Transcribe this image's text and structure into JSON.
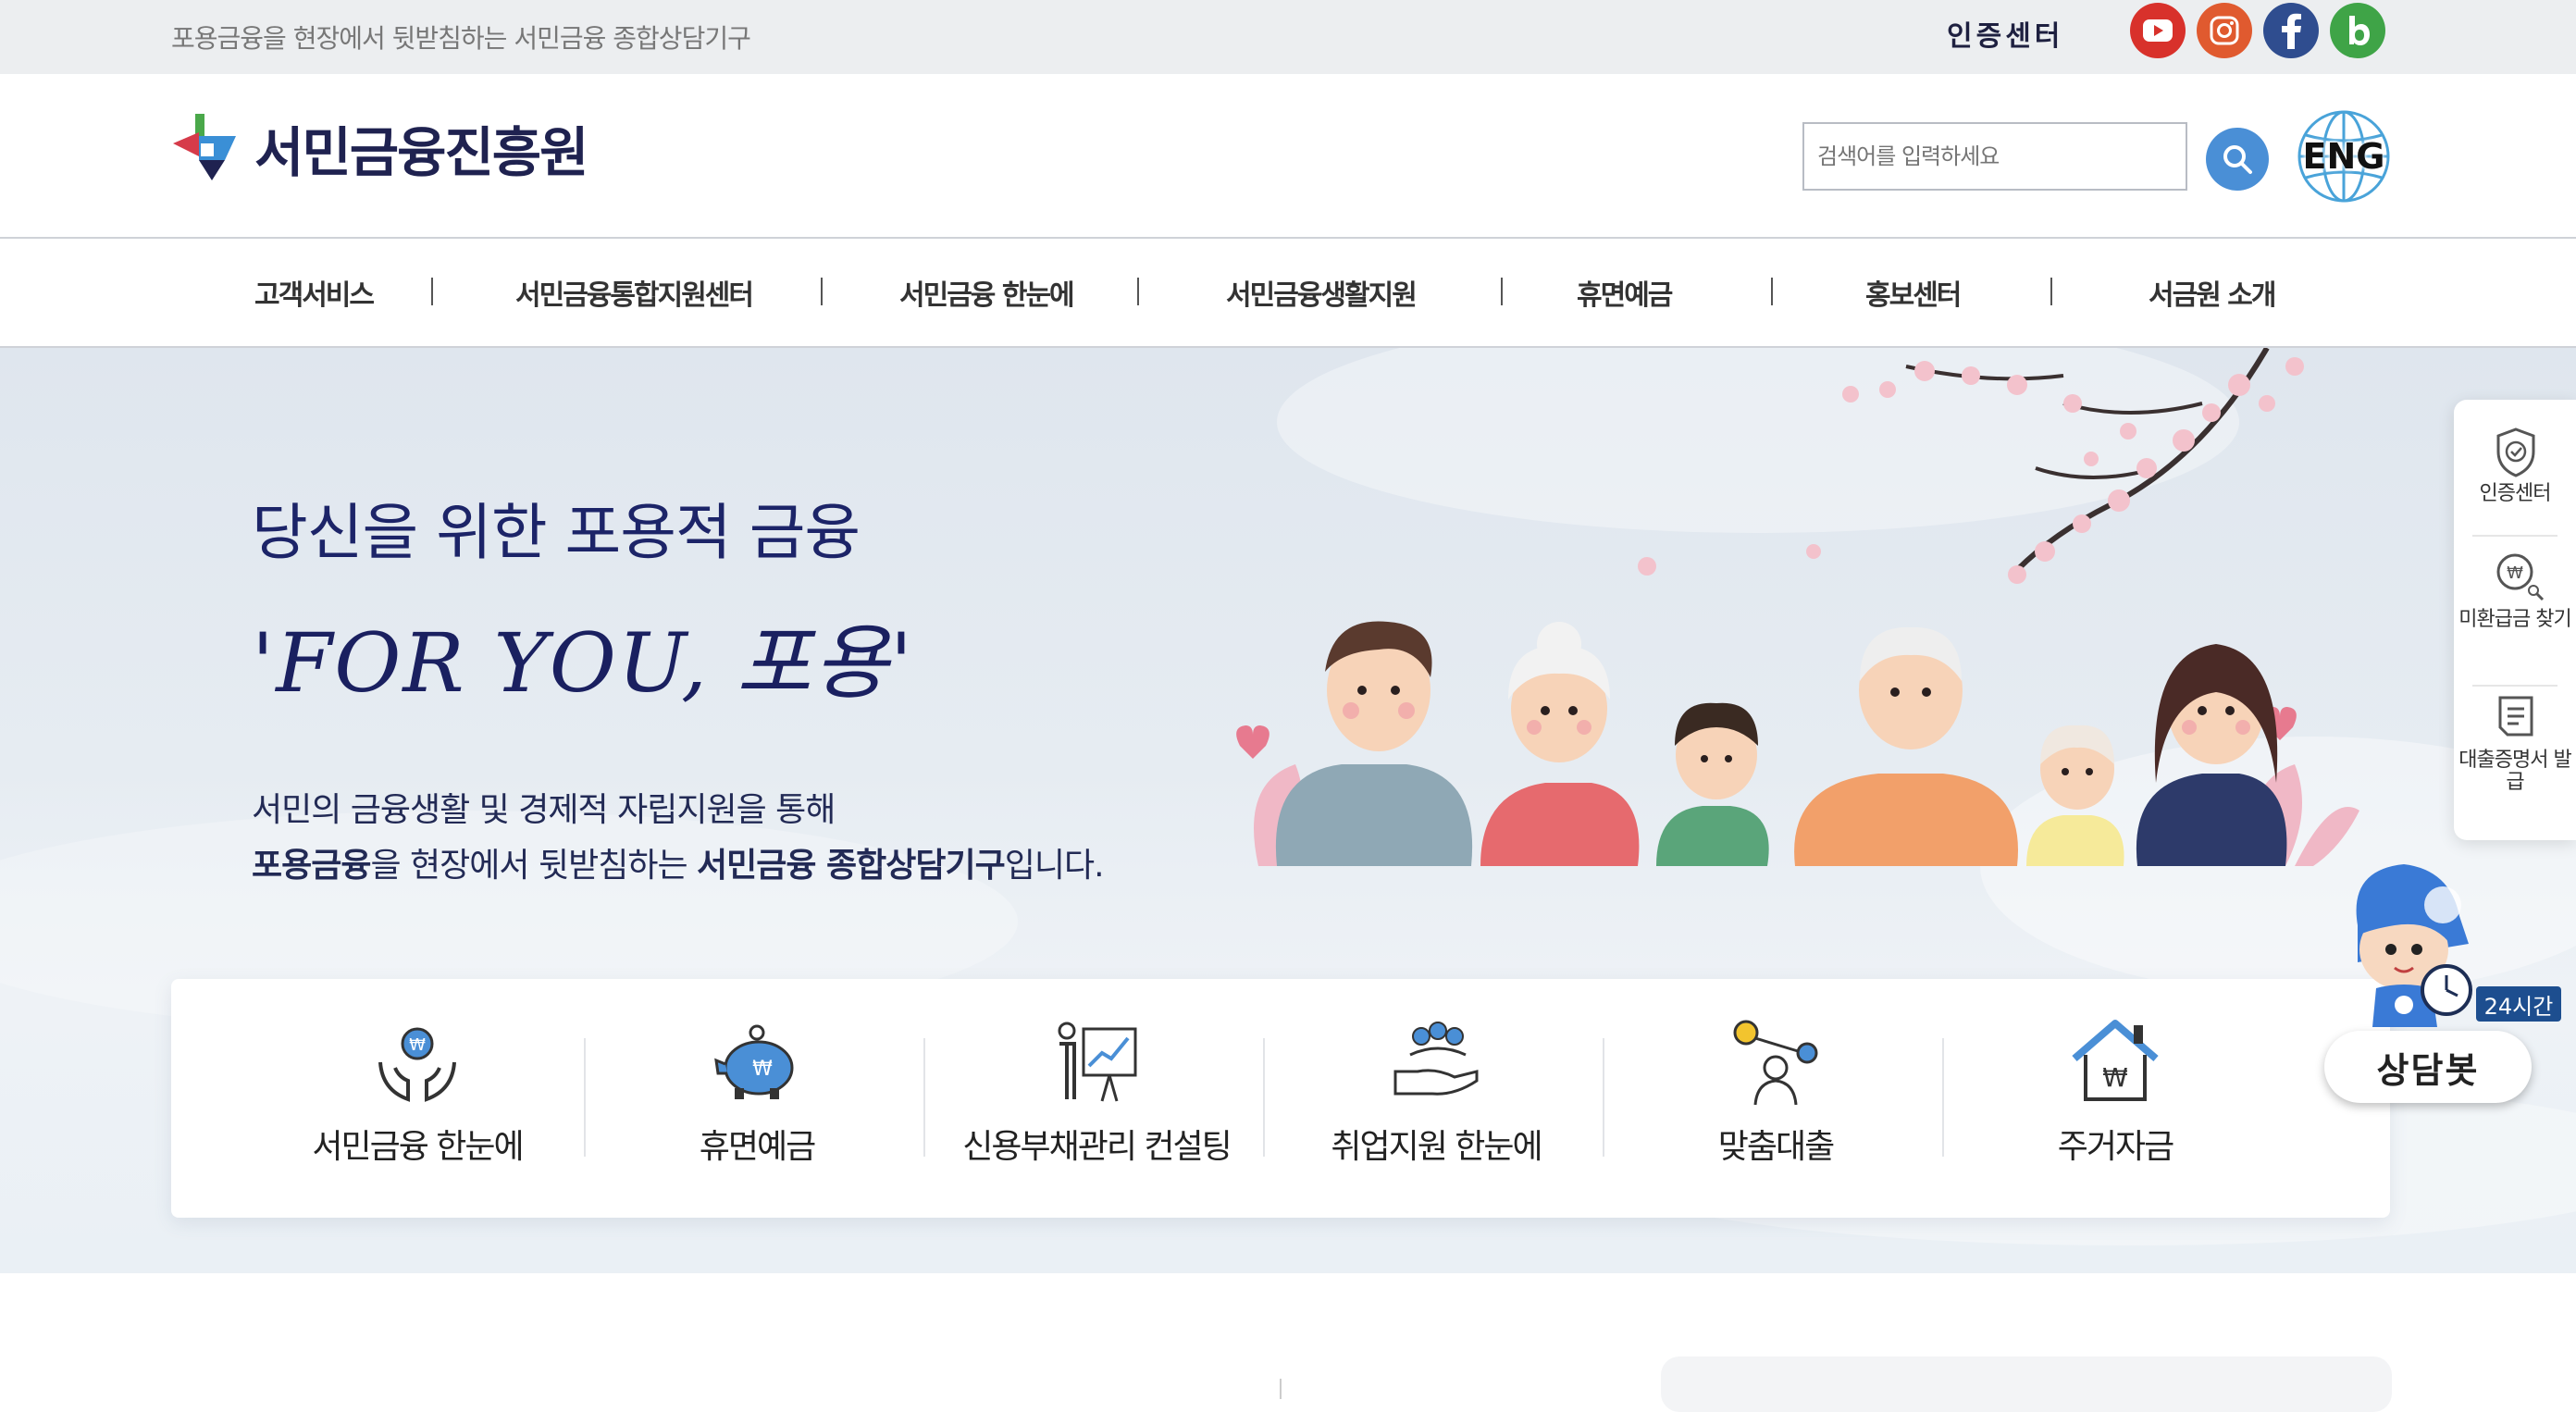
{
  "topbar": {
    "tagline": "포용금융을 현장에서 뒷받침하는 서민금융 종합상담기구",
    "cert_center": "인증센터",
    "sns": [
      {
        "name": "youtube",
        "color": "#d8312b"
      },
      {
        "name": "instagram",
        "color": "#e05a2f"
      },
      {
        "name": "facebook",
        "color": "#2f4d8f"
      },
      {
        "name": "blog",
        "color": "#3fa447"
      }
    ]
  },
  "header": {
    "logo_text": "서민금융진흥원",
    "search_placeholder": "검색어를 입력하세요",
    "eng_label": "ENG"
  },
  "nav": {
    "items": [
      "고객서비스",
      "서민금융통합지원센터",
      "서민금융 한눈에",
      "서민금융생활지원",
      "휴면예금",
      "홍보센터",
      "서금원 소개"
    ]
  },
  "hero": {
    "title": "당신을 위한 포용적 금융",
    "slogan": "'FOR YOU, 포용'",
    "desc_line1": "서민의 금융생활 및 경제적 자립지원을 통해",
    "desc_line2_b1": "포용금융",
    "desc_line2_t1": "을 현장에서 뒷받침하는 ",
    "desc_line2_b2": "서민금융 종합상담기구",
    "desc_line2_t2": "입니다."
  },
  "quick_menu": [
    {
      "label": "서민금융 한눈에",
      "icon": "hands-coin-icon"
    },
    {
      "label": "휴면예금",
      "icon": "piggy-bank-icon"
    },
    {
      "label": "신용부채관리 컨설팅",
      "icon": "consulting-icon"
    },
    {
      "label": "취업지원 한눈에",
      "icon": "job-support-icon"
    },
    {
      "label": "맞춤대출",
      "icon": "custom-loan-icon"
    },
    {
      "label": "주거자금",
      "icon": "house-fund-icon"
    }
  ],
  "side_panel": [
    {
      "label": "인증센터",
      "icon": "shield-check-icon"
    },
    {
      "label": "미환급금 찾기",
      "icon": "coin-search-icon"
    },
    {
      "label": "대출증명서 발급",
      "icon": "document-icon"
    }
  ],
  "chatbot": {
    "badge": "24시간",
    "label": "상담봇"
  },
  "colors": {
    "brand_navy": "#1f2250",
    "accent_blue": "#4a8fd6",
    "hero_text": "#1c2468"
  }
}
